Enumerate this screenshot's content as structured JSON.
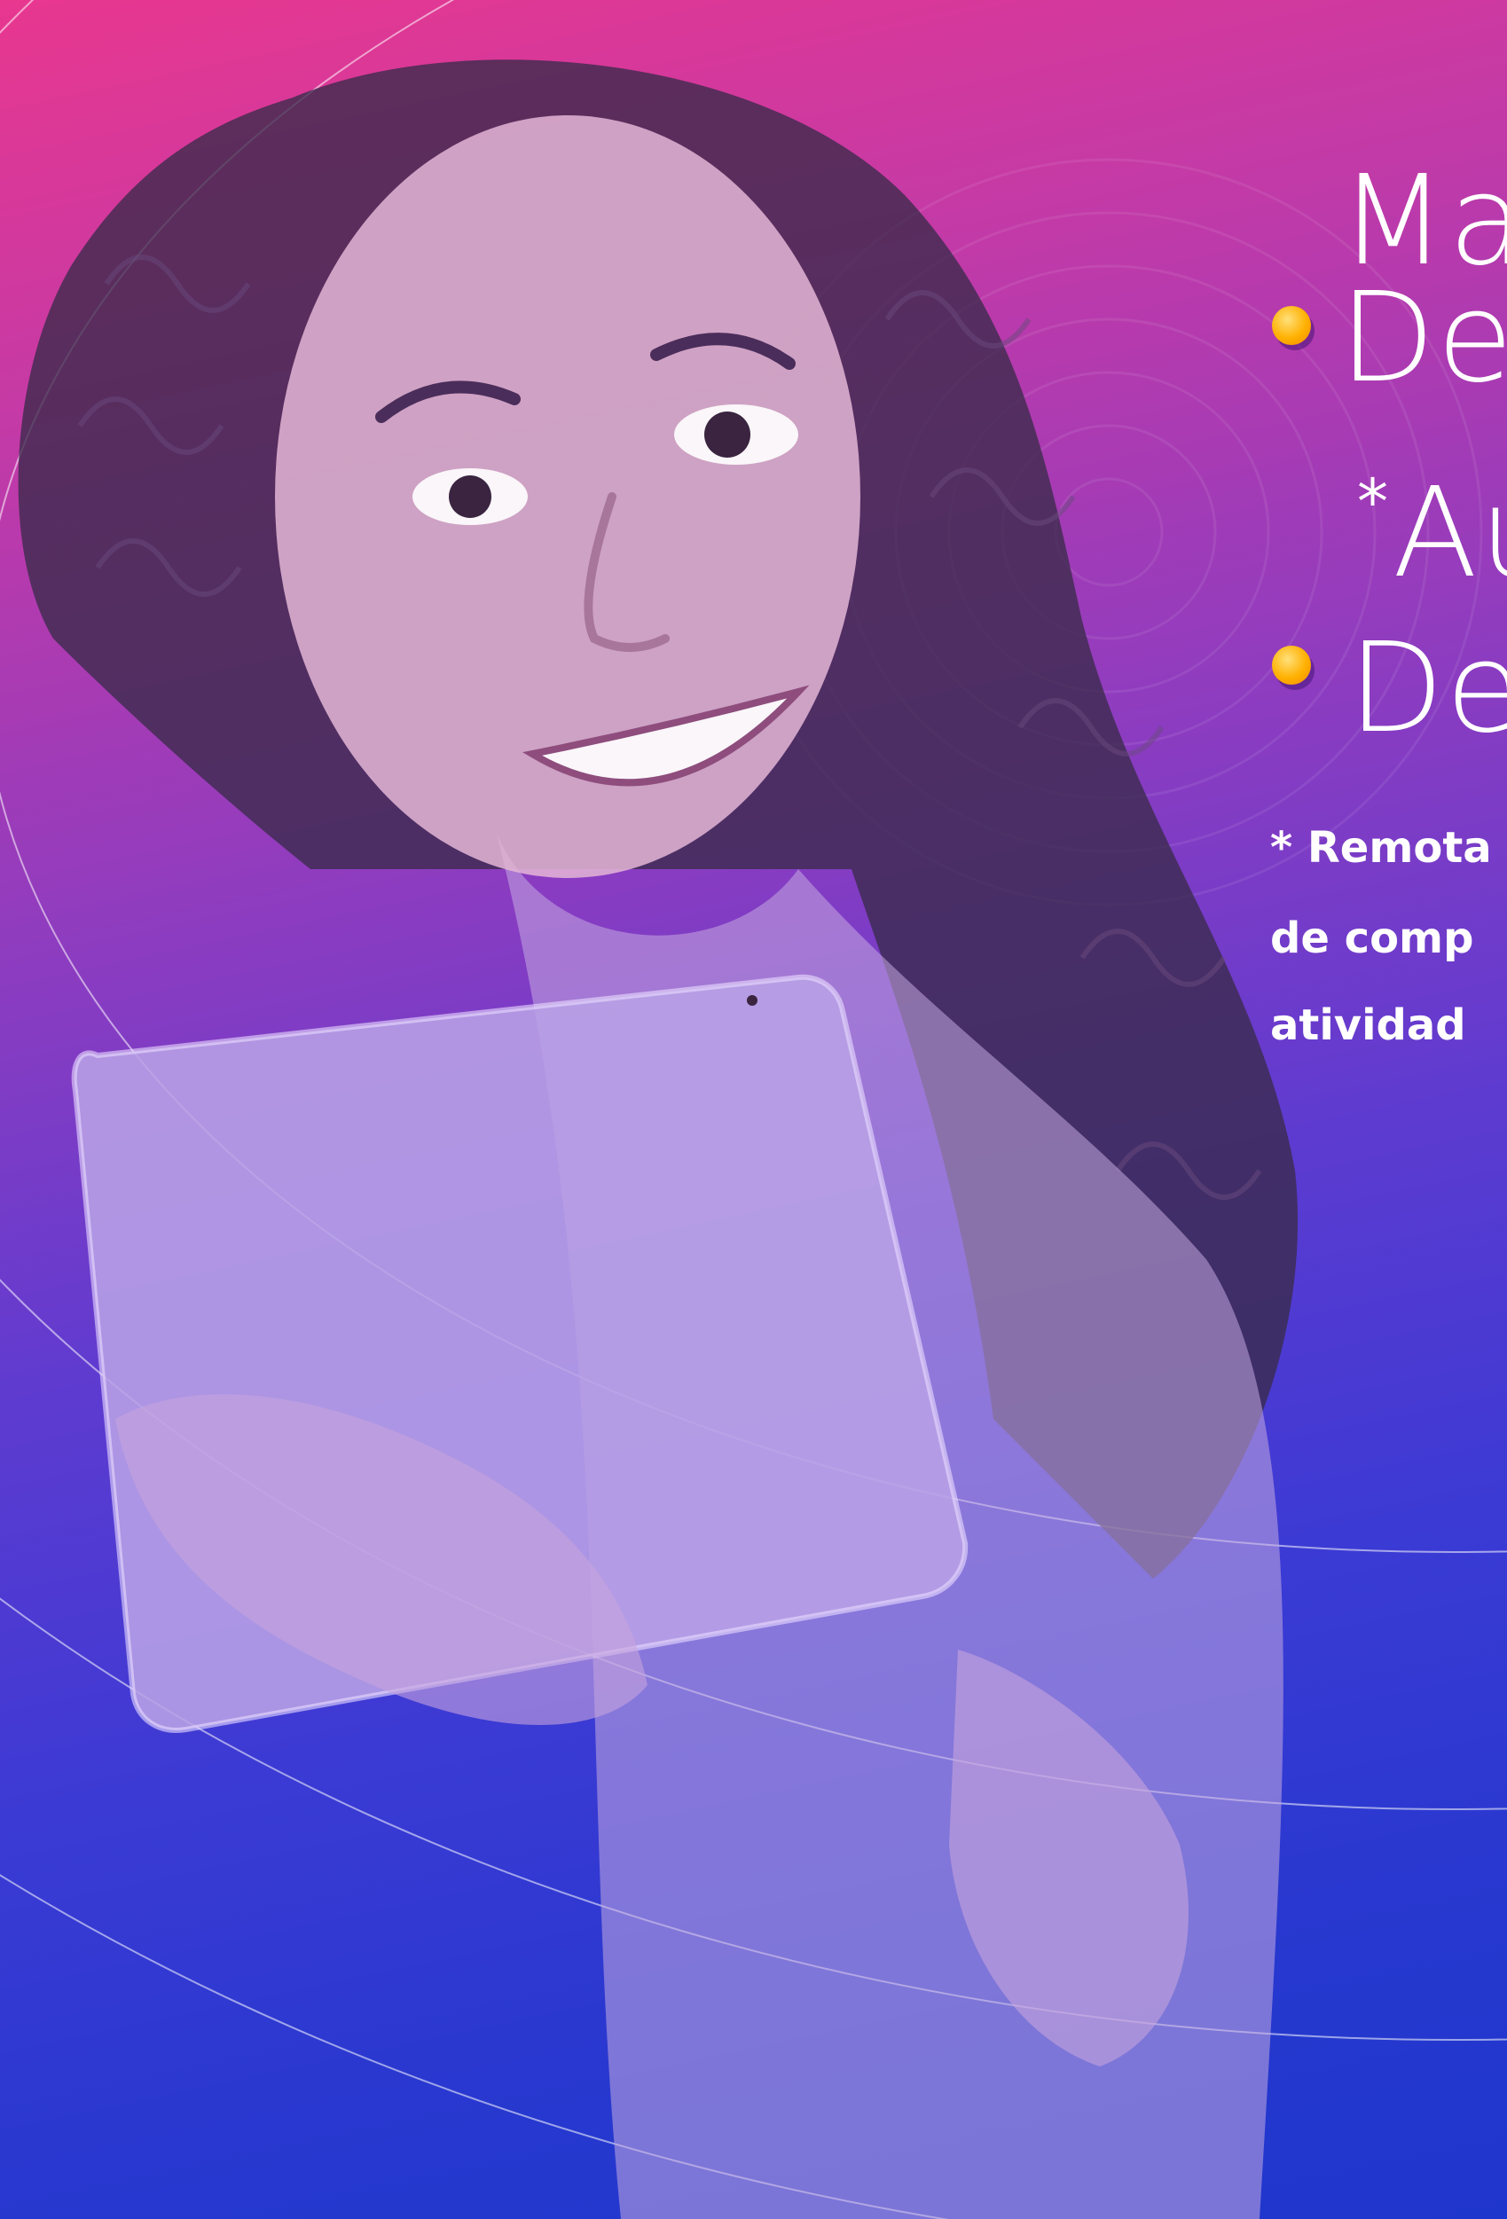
{
  "headline": {
    "line1": "Ma",
    "line2": "De",
    "line3_prefix": "*",
    "line3": "Au",
    "line4": "De"
  },
  "footnote": {
    "line1": "* Remota",
    "line2": "de comp",
    "line3": "atividad"
  },
  "colors": {
    "bullet": "#ffb000",
    "gradient_top": "#e8378f",
    "gradient_bottom": "#1f36cc"
  }
}
